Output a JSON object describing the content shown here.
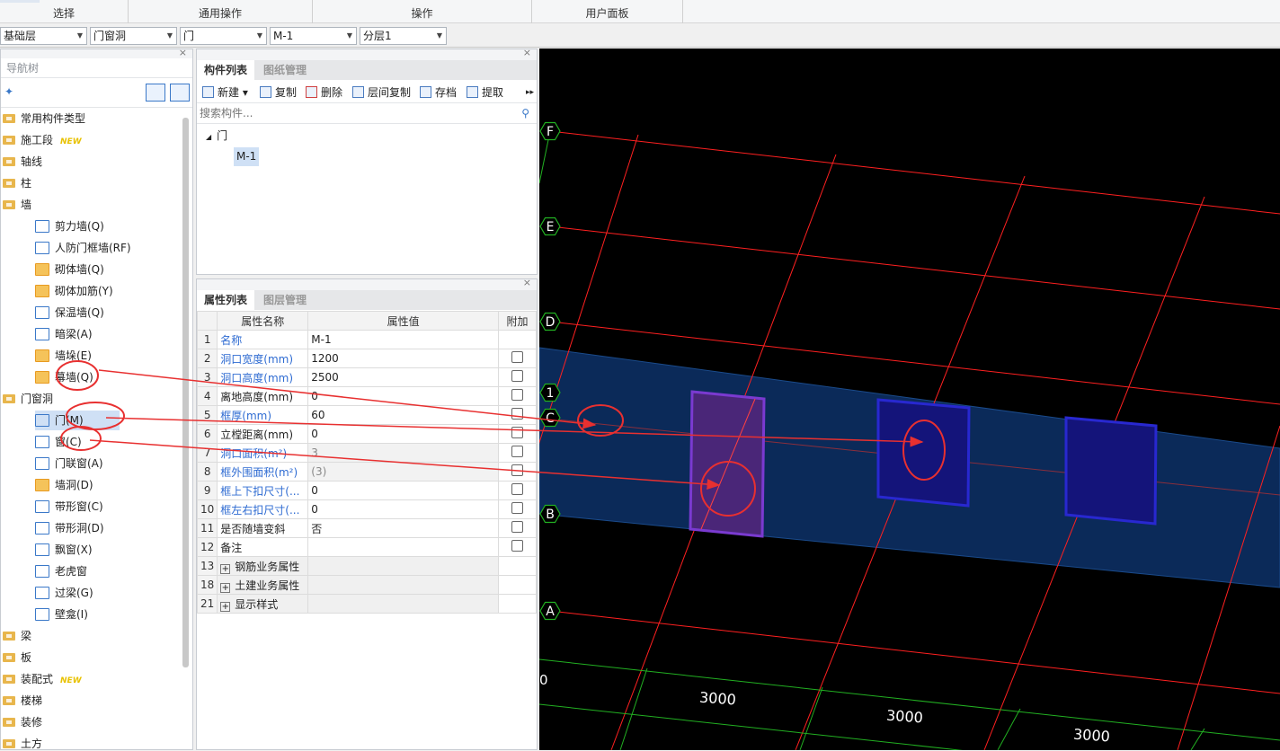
{
  "ribbon": {
    "groups": [
      "选择",
      "通用操作",
      "操作",
      "用户面板"
    ]
  },
  "selectors": [
    {
      "name": "floor-select",
      "value": "基础层"
    },
    {
      "name": "category-select",
      "value": "门窗洞"
    },
    {
      "name": "type-select",
      "value": "门"
    },
    {
      "name": "component-select",
      "value": "M-1"
    },
    {
      "name": "layer-select",
      "value": "分层1"
    }
  ],
  "nav": {
    "title": "导航树",
    "close": "×",
    "items": [
      {
        "label": "常用构件类型",
        "level": 0,
        "icon": "folder-icon"
      },
      {
        "label": "施工段",
        "level": 0,
        "icon": "folder-icon",
        "badge": "NEW"
      },
      {
        "label": "轴线",
        "level": 0,
        "icon": "folder-icon"
      },
      {
        "label": "柱",
        "level": 0,
        "icon": "folder-icon"
      },
      {
        "label": "墙",
        "level": 0,
        "icon": "folder-open-icon"
      },
      {
        "label": "剪力墙(Q)",
        "level": 1,
        "icon": "shear-wall-icon"
      },
      {
        "label": "人防门框墙(RF)",
        "level": 1,
        "icon": "civil-defense-wall-icon"
      },
      {
        "label": "砌体墙(Q)",
        "level": 1,
        "icon": "masonry-wall-icon"
      },
      {
        "label": "砌体加筋(Y)",
        "level": 1,
        "icon": "masonry-rebar-icon"
      },
      {
        "label": "保温墙(Q)",
        "level": 1,
        "icon": "insulation-wall-icon"
      },
      {
        "label": "暗梁(A)",
        "level": 1,
        "icon": "hidden-beam-icon"
      },
      {
        "label": "墙垛(E)",
        "level": 1,
        "icon": "wall-pier-icon"
      },
      {
        "label": "幕墙(Q)",
        "level": 1,
        "icon": "curtain-wall-icon"
      },
      {
        "label": "门窗洞",
        "level": 0,
        "icon": "folder-open-icon"
      },
      {
        "label": "门(M)",
        "level": 1,
        "icon": "door-icon",
        "selected": true
      },
      {
        "label": "窗(C)",
        "level": 1,
        "icon": "window-icon"
      },
      {
        "label": "门联窗(A)",
        "level": 1,
        "icon": "door-window-icon"
      },
      {
        "label": "墙洞(D)",
        "level": 1,
        "icon": "wall-hole-icon"
      },
      {
        "label": "带形窗(C)",
        "level": 1,
        "icon": "strip-window-icon"
      },
      {
        "label": "带形洞(D)",
        "level": 1,
        "icon": "strip-hole-icon"
      },
      {
        "label": "飘窗(X)",
        "level": 1,
        "icon": "bay-window-icon"
      },
      {
        "label": "老虎窗",
        "level": 1,
        "icon": "dormer-icon"
      },
      {
        "label": "过梁(G)",
        "level": 1,
        "icon": "lintel-icon"
      },
      {
        "label": "壁龛(I)",
        "level": 1,
        "icon": "niche-icon"
      },
      {
        "label": "梁",
        "level": 0,
        "icon": "folder-icon"
      },
      {
        "label": "板",
        "level": 0,
        "icon": "folder-icon"
      },
      {
        "label": "装配式",
        "level": 0,
        "icon": "folder-icon",
        "badge": "NEW"
      },
      {
        "label": "楼梯",
        "level": 0,
        "icon": "folder-icon"
      },
      {
        "label": "装修",
        "level": 0,
        "icon": "folder-icon"
      },
      {
        "label": "土方",
        "level": 0,
        "icon": "folder-icon"
      }
    ]
  },
  "component_list": {
    "tabs": [
      "构件列表",
      "图纸管理"
    ],
    "toolbar": [
      "新建",
      "复制",
      "删除",
      "层间复制",
      "存档",
      "提取"
    ],
    "search_placeholder": "搜索构件...",
    "tree_root": "门",
    "tree_child": "M-1"
  },
  "properties": {
    "tabs": [
      "属性列表",
      "图层管理"
    ],
    "headers": [
      "属性名称",
      "属性值",
      "附加"
    ],
    "rows": [
      {
        "n": "1",
        "name": "名称",
        "value": "M-1",
        "blue": true,
        "cb": false
      },
      {
        "n": "2",
        "name": "洞口宽度(mm)",
        "value": "1200",
        "blue": true,
        "cb": true
      },
      {
        "n": "3",
        "name": "洞口高度(mm)",
        "value": "2500",
        "blue": true,
        "cb": true
      },
      {
        "n": "4",
        "name": "离地高度(mm)",
        "value": "0",
        "blue": false,
        "cb": true
      },
      {
        "n": "5",
        "name": "框厚(mm)",
        "value": "60",
        "blue": true,
        "cb": true
      },
      {
        "n": "6",
        "name": "立樘距离(mm)",
        "value": "0",
        "blue": false,
        "cb": true
      },
      {
        "n": "7",
        "name": "洞口面积(m²)",
        "value": "3",
        "blue": true,
        "cb": true,
        "grey": true
      },
      {
        "n": "8",
        "name": "框外围面积(m²)",
        "value": "(3)",
        "blue": true,
        "cb": true,
        "grey": true
      },
      {
        "n": "9",
        "name": "框上下扣尺寸(...",
        "value": "0",
        "blue": true,
        "cb": true
      },
      {
        "n": "10",
        "name": "框左右扣尺寸(...",
        "value": "0",
        "blue": true,
        "cb": true
      },
      {
        "n": "11",
        "name": "是否随墙变斜",
        "value": "否",
        "blue": false,
        "cb": true
      },
      {
        "n": "12",
        "name": "备注",
        "value": "",
        "blue": false,
        "cb": true
      }
    ],
    "groups": [
      {
        "n": "13",
        "name": "钢筋业务属性"
      },
      {
        "n": "18",
        "name": "土建业务属性"
      },
      {
        "n": "21",
        "name": "显示样式"
      }
    ]
  },
  "canvas": {
    "axis_labels": [
      "F",
      "E",
      "D",
      "1",
      "C",
      "B",
      "A"
    ],
    "dimensions": [
      "3000",
      "3000",
      "3000"
    ],
    "left_number": "0",
    "colors": {
      "grid_red": "#ff2020",
      "grid_green": "#22b022",
      "wall": "#0a2a5a",
      "door": "#5a2a9a",
      "window": "#1414a0",
      "annotation": "#e83030"
    }
  }
}
